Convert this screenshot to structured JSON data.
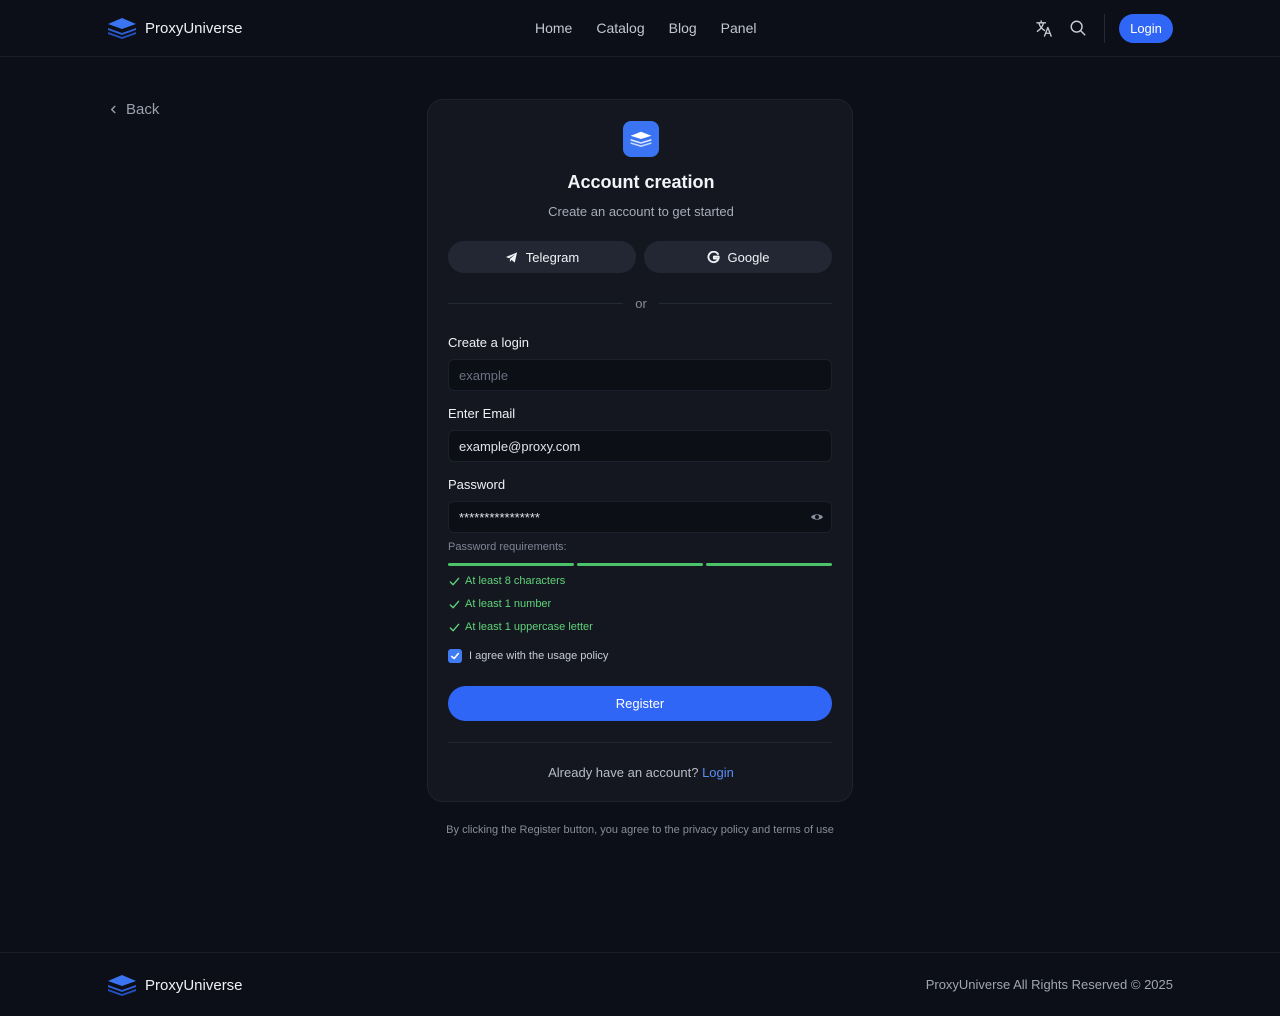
{
  "brand": {
    "name": "ProxyUniverse",
    "accent": "#2f66f6"
  },
  "nav": {
    "items": [
      "Home",
      "Catalog",
      "Blog",
      "Panel"
    ]
  },
  "header": {
    "login_label": "Login",
    "icons": [
      "translate-icon",
      "search-icon"
    ]
  },
  "back_label": "Back",
  "card": {
    "title": "Account creation",
    "subtitle": "Create an account to get started",
    "telegram_label": "Telegram",
    "google_label": "Google",
    "or_label": "or",
    "login_field": {
      "label": "Create a login",
      "placeholder": "example",
      "value": ""
    },
    "email_field": {
      "label": "Enter Email",
      "value": "example@proxy.com"
    },
    "password_field": {
      "label": "Password",
      "value": "****************"
    },
    "requirements": {
      "title": "Password requirements:",
      "strength_segments_filled": 3,
      "strength_segments_total": 3,
      "items": [
        "At least 8 characters",
        "At least 1 number",
        "At least 1 uppercase letter"
      ],
      "color": "#4cc26b"
    },
    "agree_label": "I agree with the usage policy",
    "agree_checked": true,
    "register_label": "Register",
    "already_text": "Already have an account?",
    "already_link": "Login"
  },
  "disclaimer": "By clicking the Register button, you agree to the privacy policy and terms of use",
  "footer": {
    "copyright": "ProxyUniverse All Rights Reserved © 2025"
  }
}
